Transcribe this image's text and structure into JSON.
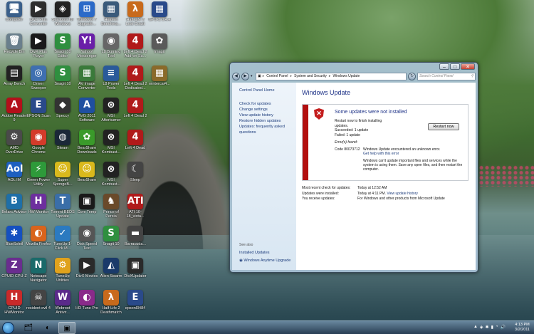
{
  "desktop_icons": [
    {
      "label": "Computer",
      "glyph": "🖥",
      "color": "#3a5f8a"
    },
    {
      "label": "Recycle Bin",
      "glyph": "🗑",
      "color": "#6a7f8c"
    },
    {
      "label": "Array Bench",
      "glyph": "▤",
      "color": "#222"
    },
    {
      "label": "Adobe Reader 9",
      "glyph": "A",
      "color": "#b3101a"
    },
    {
      "label": "AMD OverDrive",
      "glyph": "⚙",
      "color": "#4a4a4a"
    },
    {
      "label": "AOL IM",
      "glyph": "Aol",
      "color": "#1d5fbf"
    },
    {
      "label": "Belarc Advisor",
      "glyph": "B",
      "color": "#1e6fa8"
    },
    {
      "label": "BlueSoleil",
      "glyph": "✱",
      "color": "#1550c0"
    },
    {
      "label": "CPUID CPU-Z",
      "glyph": "Z",
      "color": "#6a2d8f"
    },
    {
      "label": "CPUID HWMonitor",
      "glyph": "H",
      "color": "#c82a2a"
    },
    {
      "label": "DivX Plus Converter",
      "glyph": "▶",
      "color": "#2d2d2d"
    },
    {
      "label": "DivX Plus Player",
      "glyph": "▶",
      "color": "#1a1a1a"
    },
    {
      "label": "Driver Sweeper",
      "glyph": "◎",
      "color": "#3f6fb0"
    },
    {
      "label": "EPSON Scan",
      "glyph": "E",
      "color": "#2a4a8a"
    },
    {
      "label": "Google Chrome",
      "glyph": "◉",
      "color": "#d43b2a"
    },
    {
      "label": "Green Power Utility",
      "glyph": "⚡",
      "color": "#2e9a3a"
    },
    {
      "label": "HW Monitor",
      "glyph": "H",
      "color": "#6d2f9e"
    },
    {
      "label": "Mozilla Firefox",
      "glyph": "◐",
      "color": "#d9641c"
    },
    {
      "label": "Netscape Navigator",
      "glyph": "N",
      "color": "#1a6a6a"
    },
    {
      "label": "resident evil 4",
      "glyph": "☠",
      "color": "#444"
    },
    {
      "label": "SeaTools for Windows",
      "glyph": "◈",
      "color": "#222"
    },
    {
      "label": "Snagit 10 Editor",
      "glyph": "S",
      "color": "#2f8f3f"
    },
    {
      "label": "Snagit 10",
      "glyph": "S",
      "color": "#2f8f3f"
    },
    {
      "label": "Speccy",
      "glyph": "◆",
      "color": "#333"
    },
    {
      "label": "Steam",
      "glyph": "◍",
      "color": "#1b2838"
    },
    {
      "label": "Super SpongeB...",
      "glyph": "☺",
      "color": "#d9b91c"
    },
    {
      "label": "Torrent BEDS Update",
      "glyph": "T",
      "color": "#3a6ea8"
    },
    {
      "label": "TuneUp 1-Click M...",
      "glyph": "✓",
      "color": "#2b7ac0"
    },
    {
      "label": "TuneUp Utilities",
      "glyph": "⚙",
      "color": "#e0a21c"
    },
    {
      "label": "Webroot Antivir...",
      "glyph": "W",
      "color": "#5a2a8a"
    },
    {
      "label": "Windows 7 Upgrade...",
      "glyph": "⊞",
      "color": "#2b6ac8"
    },
    {
      "label": "Yahoo! Messenger",
      "glyph": "Y!",
      "color": "#6a1fa8"
    },
    {
      "label": "AV Image Converter",
      "glyph": "▦",
      "color": "#3a7a3a"
    },
    {
      "label": "AVG 2011 Software",
      "glyph": "A",
      "color": "#1f4fa0"
    },
    {
      "label": "BearShare Downloads",
      "glyph": "✿",
      "color": "#3a9a2a"
    },
    {
      "label": "BearShare",
      "glyph": "☺",
      "color": "#d9b91c"
    },
    {
      "label": "Core Temp",
      "glyph": "▣",
      "color": "#1a1a1a"
    },
    {
      "label": "Disk Speed Test",
      "glyph": "◉",
      "color": "#555"
    },
    {
      "label": "DivX Movies",
      "glyph": "▶",
      "color": "#2a2a2a"
    },
    {
      "label": "HD Tune Pro",
      "glyph": "◐",
      "color": "#8a2a8a"
    },
    {
      "label": "Heaven Benchma...",
      "glyph": "▦",
      "color": "#3a5a7a"
    },
    {
      "label": "L8 Burning Tool",
      "glyph": "◉",
      "color": "#666"
    },
    {
      "label": "L8 Power Tools",
      "glyph": "≡",
      "color": "#2a5a9a"
    },
    {
      "label": "MSI Afterburner",
      "glyph": "⊛",
      "color": "#222"
    },
    {
      "label": "MSI Kombust...",
      "glyph": "⊗",
      "color": "#222"
    },
    {
      "label": "MSI Kombust...",
      "glyph": "⊗",
      "color": "#222"
    },
    {
      "label": "Prince of Persia",
      "glyph": "♞",
      "color": "#6a4a2a"
    },
    {
      "label": "Snagit 10",
      "glyph": "S",
      "color": "#2f8f3f"
    },
    {
      "label": "Alien Swarm",
      "glyph": "◭",
      "color": "#1a3a6a"
    },
    {
      "label": "Half-Life 2 Deathmatch",
      "glyph": "λ",
      "color": "#c86a1c"
    },
    {
      "label": "Half-Life 2 Lost Coast",
      "glyph": "λ",
      "color": "#c86a1c"
    },
    {
      "label": "Left 4 Dead 2 Add-on Su...",
      "glyph": "4",
      "color": "#b01a1a"
    },
    {
      "label": "Left 4 Dead 2 Dedicated...",
      "glyph": "4",
      "color": "#b01a1a"
    },
    {
      "label": "Left 4 Dead 2",
      "glyph": "4",
      "color": "#b01a1a"
    },
    {
      "label": "Left 4 Dead",
      "glyph": "4",
      "color": "#b01a1a"
    },
    {
      "label": "Sleep",
      "glyph": "☾",
      "color": "#444"
    },
    {
      "label": "ATI 10-18_vista...",
      "glyph": "ATI",
      "color": "#b01a1a"
    },
    {
      "label": "Barracuda...",
      "glyph": "▬",
      "color": "#444"
    },
    {
      "label": "DivXUpdater",
      "glyph": "▣",
      "color": "#2a2a2a"
    },
    {
      "label": "epsonl3484",
      "glyph": "E",
      "color": "#2a4a8a"
    },
    {
      "label": "GPU-Z 0.4.4",
      "glyph": "▦",
      "color": "#2a4a8a"
    },
    {
      "label": "Imagit",
      "glyph": "✿",
      "color": "#5a5a5a"
    },
    {
      "label": "wintercat4...",
      "glyph": "▦",
      "color": "#8a6a2a"
    }
  ],
  "window": {
    "title_buttons": {
      "minimize": "–",
      "maximize": "□",
      "close": "✕"
    },
    "breadcrumb": [
      "Control Panel",
      "System and Security",
      "Windows Update"
    ],
    "search_placeholder": "Search Control Panel",
    "sidebar": {
      "home": "Control Panel Home",
      "links": [
        "Check for updates",
        "Change settings",
        "View update history",
        "Restore hidden updates",
        "Updates: frequently asked questions"
      ],
      "see_also": "See also",
      "bottom_links": [
        "Installed Updates",
        "Windows Anytime Upgrade"
      ]
    },
    "main": {
      "heading": "Windows Update",
      "panel": {
        "title": "Some updates were not installed",
        "restart_text": "Restart now to finish installing updates.",
        "succeeded": "Succeeded: 1 update",
        "failed": "Failed: 1 update",
        "restart_button": "Restart now",
        "errors_found": "Error(s) found:",
        "code": "Code 80073712",
        "error_text": "Windows Update encountered an unknown error.",
        "help_link": "Get help with this error",
        "warning": "Windows can't update important files and services while the system is using them. Save any open files, and then restart the computer."
      },
      "info": [
        {
          "label": "Most recent check for updates:",
          "value": "Today at 12:52 AM",
          "link": ""
        },
        {
          "label": "Updates were installed:",
          "value": "Today at 4:11 PM.",
          "link": "View update history"
        },
        {
          "label": "You receive updates:",
          "value": "For Windows and other products from Microsoft Update",
          "link": ""
        }
      ]
    }
  },
  "taskbar": {
    "tray_icons": [
      "▲",
      "◈",
      "✱",
      "▮",
      "◔",
      "🔊"
    ],
    "time": "4:13 PM",
    "date": "3/2/2011"
  }
}
